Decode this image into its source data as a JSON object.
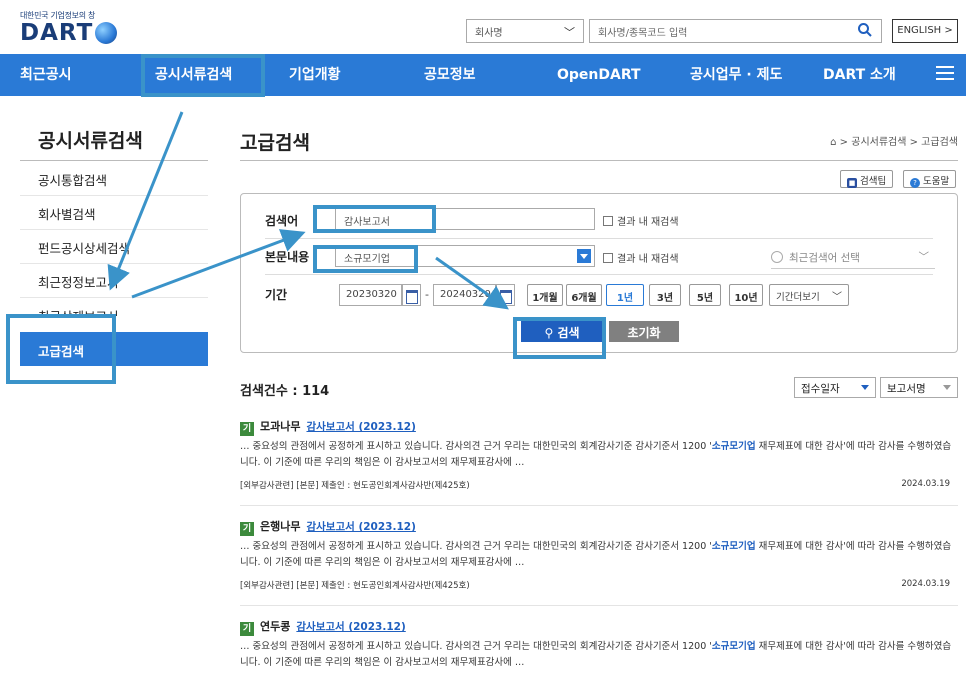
{
  "logo": {
    "tagline": "대한민국 기업정보의 창",
    "name": "DART"
  },
  "header": {
    "company_select": "회사명",
    "search_placeholder": "회사명/종목코드 입력",
    "english_label": "ENGLISH >"
  },
  "nav": {
    "items": [
      "최근공시",
      "공시서류검색",
      "기업개황",
      "공모정보",
      "OpenDART",
      "공시업무 · 제도",
      "DART 소개"
    ]
  },
  "sidebar": {
    "title": "공시서류검색",
    "items": [
      "공시통합검색",
      "회사별검색",
      "펀드공시상세검색",
      "최근정정보고서",
      "최근삭제보고서"
    ],
    "active_item": "고급검색"
  },
  "main": {
    "title": "고급검색",
    "breadcrumb": "공시서류검색 > 고급검색",
    "tip_label": "검색팁",
    "help_label": "도움말"
  },
  "form": {
    "keyword_label": "검색어",
    "keyword_value": "감사보고서",
    "content_label": "본문내용",
    "content_value": "소규모기업",
    "recheck_label": "결과 내 재검색",
    "recent_label": "최근검색어 선택",
    "period_label": "기간",
    "date_from": "20230320",
    "date_to": "20240320",
    "date_dash": "-",
    "period_buttons": [
      "1개월",
      "6개월",
      "1년",
      "3년",
      "5년",
      "10년"
    ],
    "period_selected": "1년",
    "period_more": "기간더보기",
    "search_label": "검색",
    "reset_label": "초기화"
  },
  "results": {
    "count_label": "검색건수 : 114",
    "sort_primary": "접수일자",
    "sort_secondary": "보고서명",
    "items": [
      {
        "badge": "기",
        "company": "모과나무",
        "report": "감사보고서 (2023.12)",
        "text_before": "… 중요성의 관점에서 공정하게 표시하고 있습니다. 감사의견 근거 우리는 대한민국의 회계감사기준 감사기준서 1200 '",
        "highlight": "소규모기업",
        "text_after": " 재무제표에 대한 감사'에 따라 감사를 수행하였습니다. 이 기준에 따른 우리의 책임은 이 감사보고서의 재무제표감사에 …",
        "meta": "[외부감사관련] [본문] 제출인 : 현도공인회계사감사반(제425호)",
        "date": "2024.03.19"
      },
      {
        "badge": "기",
        "company": "은행나무",
        "report": "감사보고서 (2023.12)",
        "text_before": "… 중요성의 관점에서 공정하게 표시하고 있습니다. 감사의견 근거 우리는 대한민국의 회계감사기준 감사기준서 1200 '",
        "highlight": "소규모기업",
        "text_after": " 재무제표에 대한 감사'에 따라 감사를 수행하였습니다. 이 기준에 따른 우리의 책임은 이 감사보고서의 재무제표감사에 …",
        "meta": "[외부감사관련] [본문] 제출인 : 현도공인회계사감사반(제425호)",
        "date": "2024.03.19"
      },
      {
        "badge": "기",
        "company": "연두콩",
        "report": "감사보고서 (2023.12)",
        "text_before": "… 중요성의 관점에서 공정하게 표시하고 있습니다. 감사의견 근거 우리는 대한민국의 회계감사기준 감사기준서 1200 '",
        "highlight": "소규모기업",
        "text_after": " 재무제표에 대한 감사'에 따라 감사를 수행하였습니다. 이 기준에 따른 우리의 책임은 이 감사보고서의 재무제표감사에 …"
      }
    ]
  },
  "colors": {
    "brand_blue": "#2a7ad6",
    "annotation": "#3a93c9",
    "badge_green": "#3c8a3c"
  }
}
